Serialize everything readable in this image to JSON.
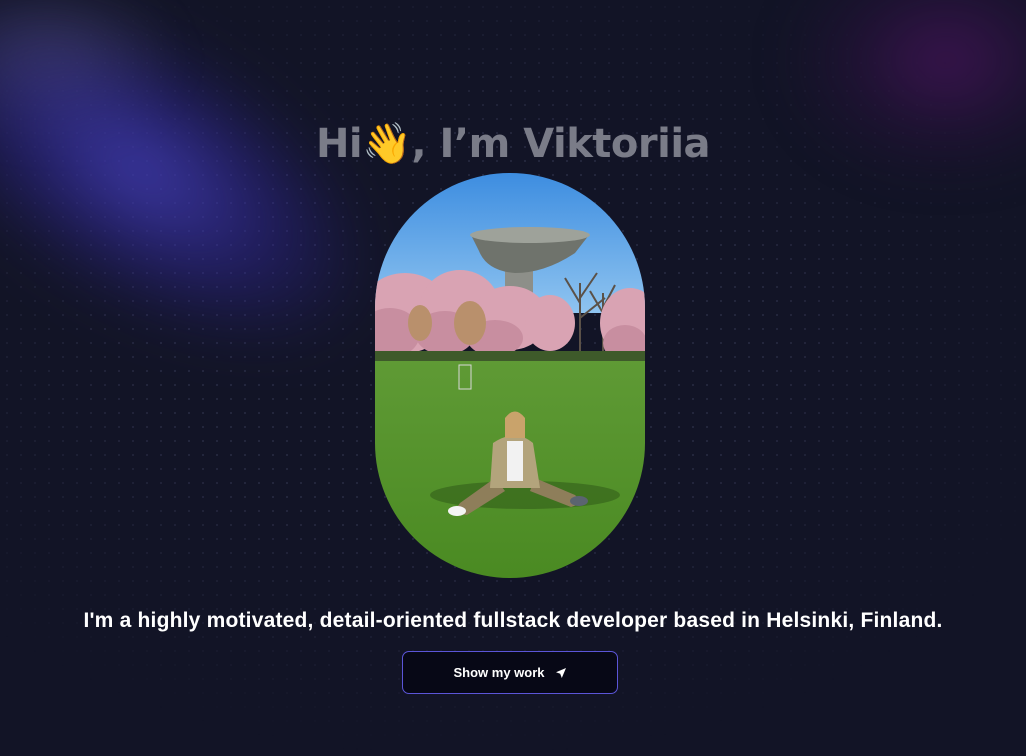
{
  "hero": {
    "title": "Hi👋, I’m Viktoriia",
    "tagline": "I'm a highly motivated, detail-oriented fullstack developer based in Helsinki, Finland.",
    "cta_label": "Show my work",
    "cta_icon": "send-arrow-icon",
    "photo": "profile-photo"
  },
  "colors": {
    "background": "#121426",
    "title_text": "#7a7c88",
    "tagline_text": "#ffffff",
    "button_background": "#070816",
    "button_border": "#5b55d8",
    "glow_left": "#4c46d2",
    "glow_right": "#5a146e"
  }
}
